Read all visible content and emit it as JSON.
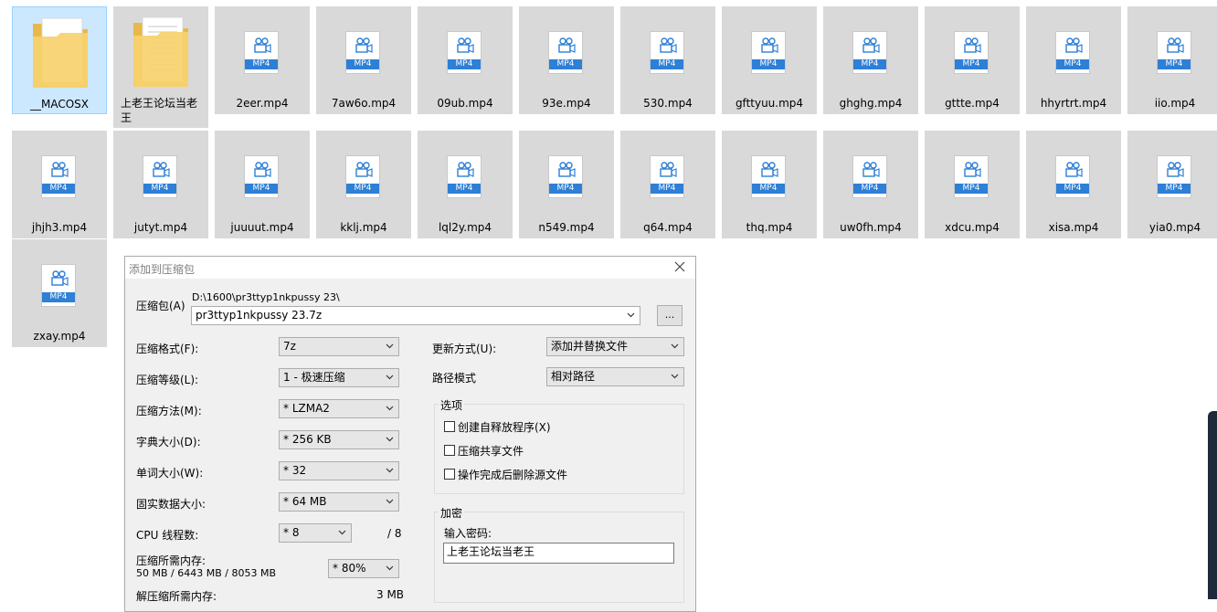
{
  "explorer": {
    "folders": [
      {
        "name": "__MACOSX",
        "selected": true
      },
      {
        "name": "上老王论坛当老王",
        "selected": false
      }
    ],
    "files_row1": [
      "2eer.mp4",
      "7aw6o.mp4",
      "09ub.mp4",
      "93e.mp4",
      "530.mp4",
      "gfttyuu.mp4",
      "ghghg.mp4",
      "gttte.mp4",
      "hhyrtrt.mp4",
      "iio.mp4"
    ],
    "files_row2": [
      "jhjh3.mp4",
      "jutyt.mp4",
      "juuuut.mp4",
      "kklj.mp4",
      "lql2y.mp4",
      "n549.mp4",
      "q64.mp4",
      "thq.mp4",
      "uw0fh.mp4",
      "xdcu.mp4",
      "xisa.mp4",
      "yia0.mp4"
    ],
    "files_row3": [
      "zxay.mp4"
    ],
    "badge": "MP4",
    "colors": {
      "tile_bg": "#d9d9d9",
      "selected_bg": "#cce8ff",
      "badge_bg": "#2e7fd6"
    }
  },
  "dialog": {
    "title": "添加到压缩包",
    "archive_label": "压缩包(A)",
    "archive_path": "D:\\1600\\pr3ttyp1nkpussy 23\\",
    "archive_name": "pr3ttyp1nkpussy 23.7z",
    "browse_label": "...",
    "format_label": "压缩格式(F):",
    "format_value": "7z",
    "level_label": "压缩等级(L):",
    "level_value": "1 - 极速压缩",
    "method_label": "压缩方法(M):",
    "method_value": "* LZMA2",
    "dict_label": "字典大小(D):",
    "dict_value": "* 256 KB",
    "word_label": "单词大小(W):",
    "word_value": "* 32",
    "solid_label": "固实数据大小:",
    "solid_value": "* 64 MB",
    "cpu_label": "CPU 线程数:",
    "cpu_value": "* 8",
    "cpu_total": "/ 8",
    "mem_label": "压缩所需内存:",
    "mem_values": "50 MB / 6443 MB / 8053 MB",
    "mem_percent": "* 80%",
    "decomp_label": "解压缩所需内存:",
    "decomp_value": "3 MB",
    "update_label": "更新方式(U):",
    "update_value": "添加并替换文件",
    "path_label": "路径模式",
    "path_value": "相对路径",
    "options_title": "选项",
    "opt_sfx": "创建自释放程序(X)",
    "opt_shared": "压缩共享文件",
    "opt_delete": "操作完成后删除源文件",
    "encrypt_title": "加密",
    "password_label": "输入密码:",
    "password_value": "上老王论坛当老王"
  }
}
